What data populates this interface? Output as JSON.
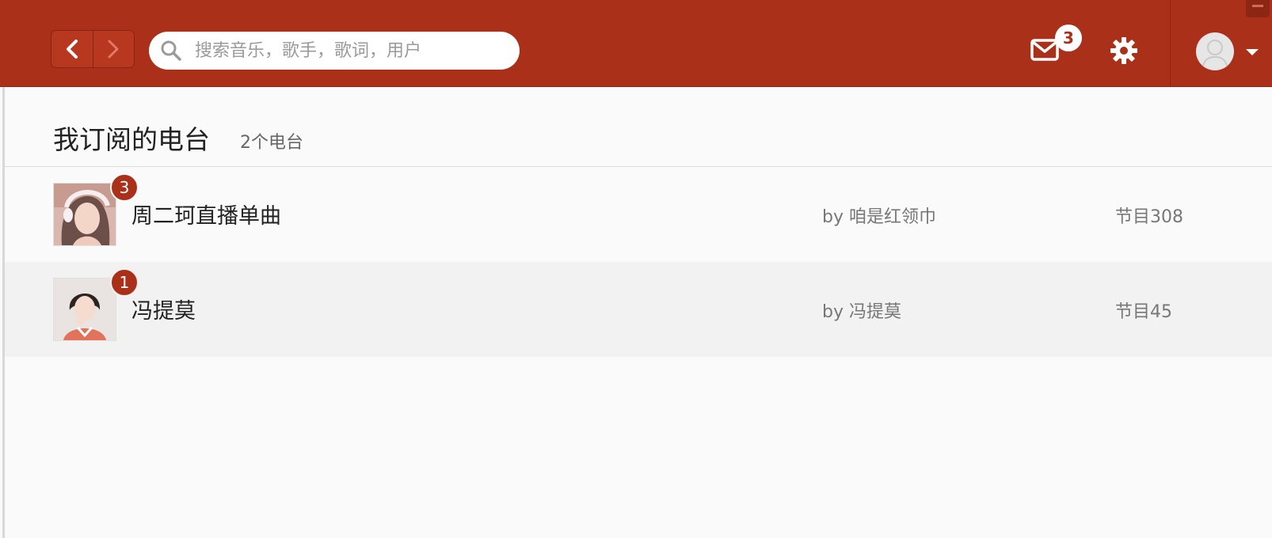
{
  "topbar": {
    "search": {
      "placeholder": "搜索音乐，歌手，歌词，用户",
      "value": ""
    },
    "mail_badge": "3",
    "accent": "#ab301a"
  },
  "page": {
    "title": "我订阅的电台",
    "count": "2个电台"
  },
  "stations": [
    {
      "name": "周二珂直播单曲",
      "by": "by 咱是红领巾",
      "programs": "节目308",
      "badge": "3"
    },
    {
      "name": "冯提莫",
      "by": "by 冯提莫",
      "programs": "节目45",
      "badge": "1"
    }
  ],
  "icons": [
    "chevron-left-icon",
    "chevron-right-icon",
    "search-icon",
    "mail-icon",
    "gear-icon",
    "user-avatar-icon",
    "caret-down-icon"
  ]
}
